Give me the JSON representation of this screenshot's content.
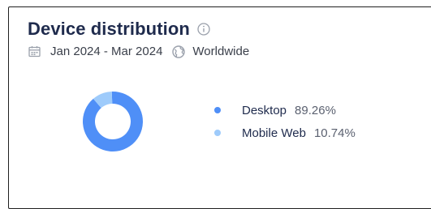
{
  "widget": {
    "title": "Device distribution",
    "date_range": "Jan 2024 - Mar 2024",
    "region": "Worldwide",
    "icons": [
      "info-icon",
      "calendar-icon",
      "globe-icon"
    ]
  },
  "chart_data": {
    "type": "pie",
    "style": "donut",
    "legend_position": "right",
    "categories": [
      "Desktop",
      "Mobile Web"
    ],
    "values": [
      89.26,
      10.74
    ],
    "labels": [
      "89.26%",
      "10.74%"
    ],
    "colors": [
      "#4f8ff7",
      "#9ecbfb"
    ]
  }
}
